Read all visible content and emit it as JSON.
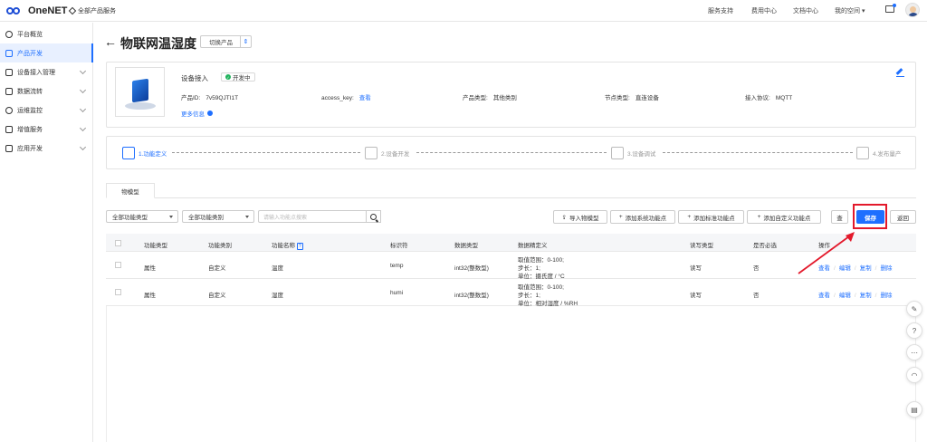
{
  "topbar": {
    "brand": "OneNET",
    "all_services": "全部产品服务",
    "nav": [
      "服务支持",
      "费用中心",
      "文档中心",
      "我的空间"
    ]
  },
  "sidebar": {
    "items": [
      {
        "label": "平台概览",
        "active": false,
        "has_chevron": false
      },
      {
        "label": "产品开发",
        "active": true,
        "has_chevron": false
      },
      {
        "label": "设备接入管理",
        "active": false,
        "has_chevron": true
      },
      {
        "label": "数据流转",
        "active": false,
        "has_chevron": true
      },
      {
        "label": "运维监控",
        "active": false,
        "has_chevron": true
      },
      {
        "label": "增值服务",
        "active": false,
        "has_chevron": true
      },
      {
        "label": "应用开发",
        "active": false,
        "has_chevron": true
      }
    ]
  },
  "page": {
    "title": "物联网温湿度",
    "switch_label": "切换产品"
  },
  "product": {
    "access_label": "设备接入",
    "status": "开发中",
    "product_id_label": "产品ID:",
    "product_id": "7v59QJTI1T",
    "access_key_label": "access_key:",
    "access_key_link": "查看",
    "type_label": "产品类型:",
    "type_value": "其他类别",
    "node_label": "节点类型:",
    "node_value": "直连设备",
    "protocol_label": "接入协议:",
    "protocol_value": "MQTT",
    "more_info": "更多信息"
  },
  "steps": [
    {
      "label": "1.功能定义",
      "active": true
    },
    {
      "label": "2.设备开发",
      "active": false
    },
    {
      "label": "3.设备调试",
      "active": false
    },
    {
      "label": "4.发布量产",
      "active": false
    }
  ],
  "tabs": {
    "model": "物模型"
  },
  "toolbar": {
    "filter_type": "全部功能类型",
    "filter_category": "全部功能类别",
    "search_placeholder": "请输入功能点搜索",
    "import_model": "导入物模型",
    "add_system": "添加系统功能点",
    "add_standard": "添加标准功能点",
    "add_custom": "添加自定义功能点",
    "view": "查",
    "save": "保存",
    "back": "返回"
  },
  "table": {
    "headers": [
      "功能类型",
      "功能类别",
      "功能名称",
      "标识符",
      "数据类型",
      "数据精定义",
      "读写类型",
      "是否必选",
      "操作"
    ],
    "rows": [
      {
        "type": "属性",
        "category": "自定义",
        "name": "温度",
        "identifier": "temp",
        "data_type": "int32(整数型)",
        "definition": [
          "取值范围：0-100;",
          "步长：1;",
          "单位：摄氏度 / °C"
        ],
        "rw": "读写",
        "required": "否"
      },
      {
        "type": "属性",
        "category": "自定义",
        "name": "湿度",
        "identifier": "humi",
        "data_type": "int32(整数型)",
        "definition": [
          "取值范围：0-100;",
          "步长：1;",
          "单位：相对湿度 / %RH"
        ],
        "rw": "读写",
        "required": "否"
      }
    ],
    "ops": [
      "查看",
      "编辑",
      "复制",
      "删除"
    ]
  },
  "colors": {
    "accent": "#1e6fff",
    "highlight": "#e3192b",
    "status_green": "#22b35e"
  }
}
